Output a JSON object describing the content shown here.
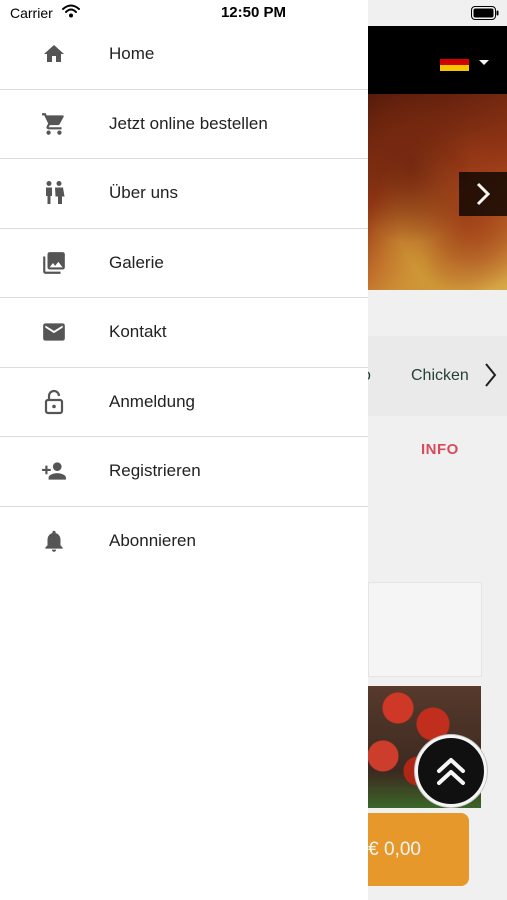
{
  "status_bar": {
    "carrier": "Carrier",
    "time": "12:50 PM"
  },
  "drawer": {
    "items": [
      {
        "label": "Home",
        "icon": "home-icon"
      },
      {
        "label": "Jetzt online bestellen",
        "icon": "cart-icon"
      },
      {
        "label": "Über uns",
        "icon": "people-icon"
      },
      {
        "label": "Galerie",
        "icon": "gallery-icon"
      },
      {
        "label": "Kontakt",
        "icon": "mail-icon"
      },
      {
        "label": "Anmeldung",
        "icon": "lock-icon"
      },
      {
        "label": "Registrieren",
        "icon": "add-person-icon"
      },
      {
        "label": "Abonnieren",
        "icon": "bell-icon"
      }
    ]
  },
  "background": {
    "category_partial": "o",
    "category_item": "Chicken",
    "tab_info": "INFO",
    "price": "€ 0,00"
  },
  "colors": {
    "accent_orange": "#f0a02c",
    "info_tab": "#e05060",
    "icon_gray": "#555555",
    "category_text": "#26453a"
  }
}
